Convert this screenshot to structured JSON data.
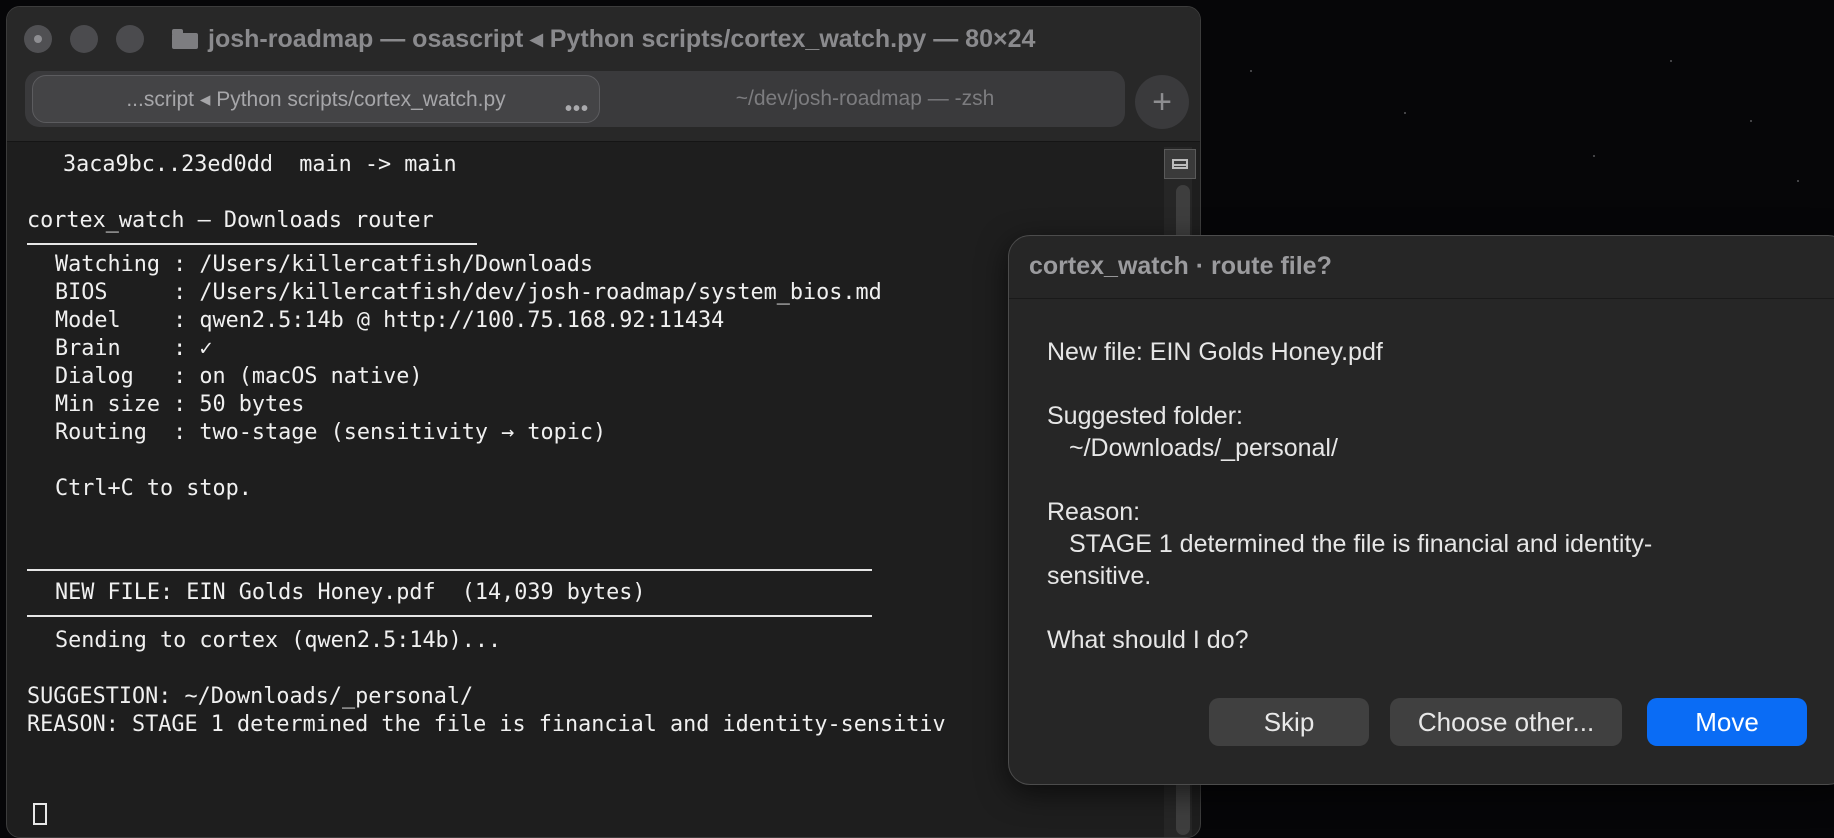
{
  "terminal": {
    "window_title": "josh-roadmap — osascript ◂ Python scripts/cortex_watch.py — 80×24",
    "tabs": [
      {
        "label": "...script ◂ Python scripts/cortex_watch.py",
        "active": true,
        "more_label": "•••"
      },
      {
        "label": "~/dev/josh-roadmap — -zsh",
        "active": false
      }
    ],
    "new_tab_label": "+",
    "lines": {
      "git": "3aca9bc..23ed0dd  main -> main",
      "header": "cortex_watch — Downloads router",
      "watching": "Watching : /Users/killercatfish/Downloads",
      "bios": "BIOS     : /Users/killercatfish/dev/josh-roadmap/system_bios.md",
      "model": "Model    : qwen2.5:14b @ http://100.75.168.92:11434",
      "brain": "Brain    : ✓",
      "dialog": "Dialog   : on (macOS native)",
      "min_size": "Min size : 50 bytes",
      "routing": "Routing  : two-stage (sensitivity → topic)",
      "stop": "Ctrl+C to stop.",
      "new_file": "NEW FILE: EIN Golds Honey.pdf  (14,039 bytes)",
      "sending": "Sending to cortex (qwen2.5:14b)...",
      "suggestion": "SUGGESTION: ~/Downloads/_personal/",
      "reason": "REASON: STAGE 1 determined the file is financial and identity-sensitiv"
    }
  },
  "dialog": {
    "title": "cortex_watch · route file?",
    "new_file": "New file:  EIN Golds Honey.pdf",
    "suggested_label": "Suggested folder:",
    "suggested_value": "~/Downloads/_personal/",
    "reason_label": "Reason:",
    "reason_value_1": "STAGE 1 determined the file is financial and identity-",
    "reason_value_2": "sensitive.",
    "question": "What should I do?",
    "buttons": {
      "skip": "Skip",
      "choose_other": "Choose other...",
      "move": "Move"
    }
  },
  "colors": {
    "accent_button": "#0a6cf5",
    "terminal_bg": "#1e1e1e",
    "dialog_bg": "#262626"
  }
}
